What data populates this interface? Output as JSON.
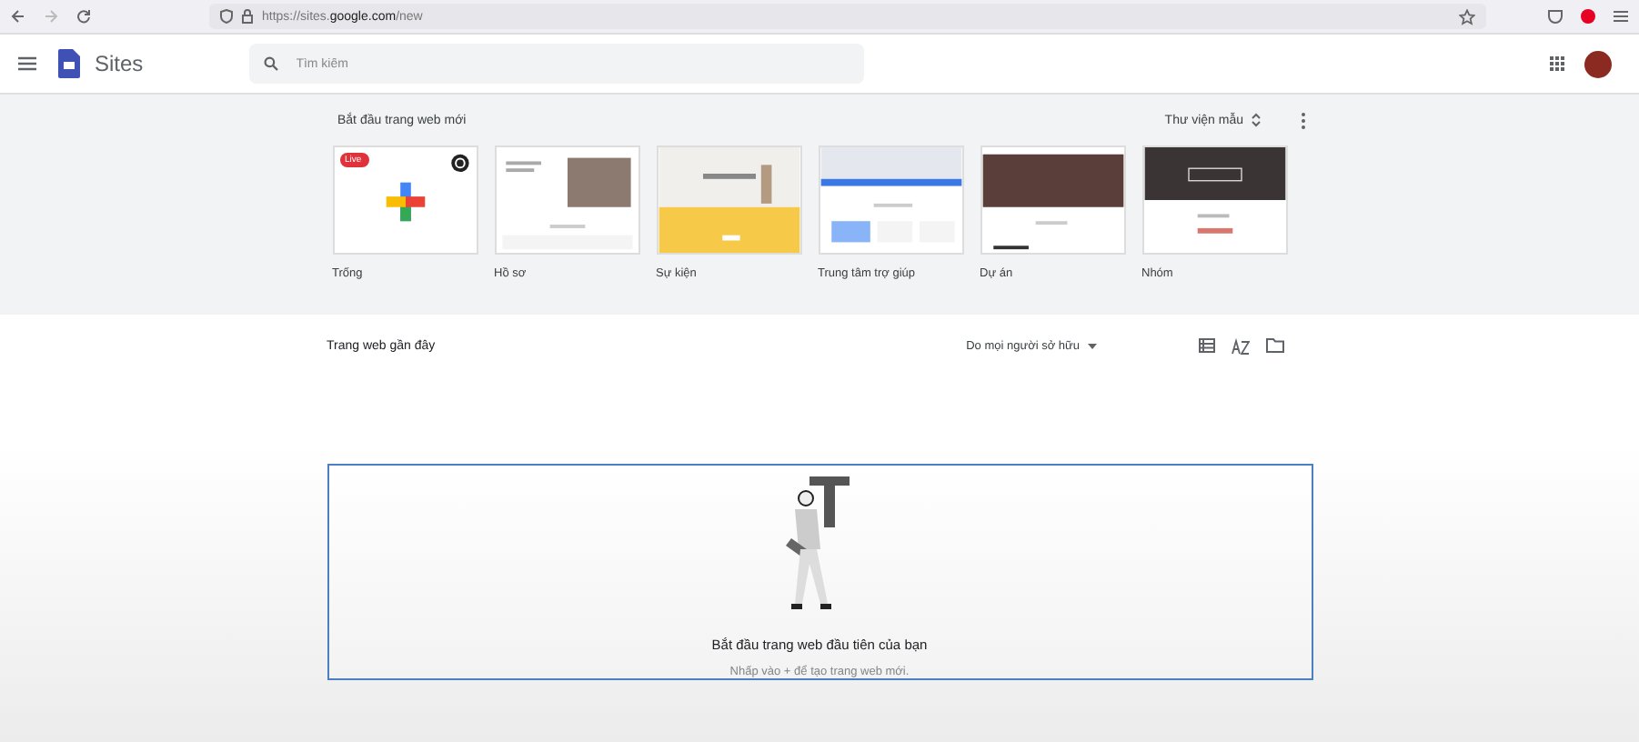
{
  "browser": {
    "url": "https://sites.**google.com**/new"
  },
  "app": {
    "title": "Sites",
    "search": {
      "placeholder": "Tìm kiếm"
    }
  },
  "gallery": {
    "title": "Bắt đầu trang web mới",
    "library_label": "Thư viện mẫu",
    "templates": [
      {
        "label": "Trống",
        "kind": "blank",
        "badge": "Live"
      },
      {
        "label": "Hồ sơ",
        "kind": "profile"
      },
      {
        "label": "Sự kiện",
        "kind": "event"
      },
      {
        "label": "Trung tâm trợ giúp",
        "kind": "help"
      },
      {
        "label": "Dự án",
        "kind": "project"
      },
      {
        "label": "Nhóm",
        "kind": "team"
      }
    ]
  },
  "recent": {
    "title": "Trang web gần đây",
    "owner_filter": "Do mọi người sở hữu"
  },
  "empty_state": {
    "heading": "Bắt đầu trang web đầu tiên của bạn",
    "hint": "Nhấp vào + để tạo trang web mới."
  }
}
